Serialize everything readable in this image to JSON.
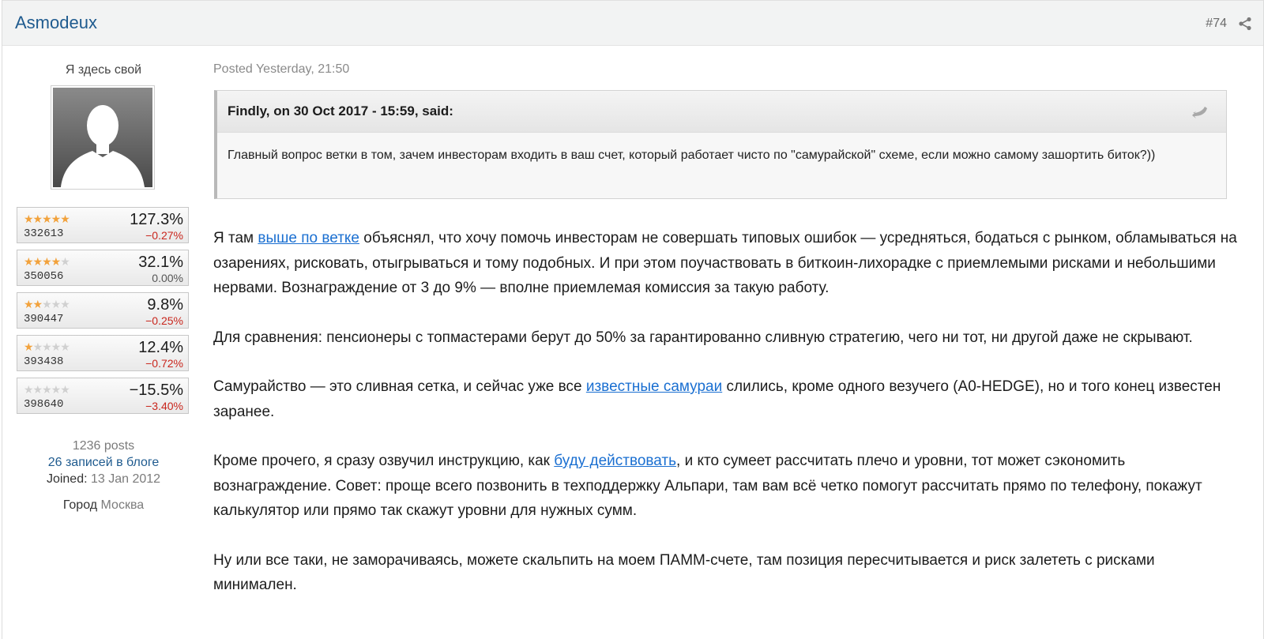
{
  "header": {
    "author": "Asmodeux",
    "post_number": "#74",
    "share_icon": "share-icon"
  },
  "author": {
    "member_title": "Я здесь свой",
    "avatar_icon": "default-avatar-icon",
    "ratings": [
      {
        "stars": 4.5,
        "id": "332613",
        "pct": "127.3%",
        "change": "−0.27%",
        "change_color": "#c9261d"
      },
      {
        "stars": 3.5,
        "id": "350056",
        "pct": "32.1%",
        "change": "0.00%",
        "change_color": "#555555"
      },
      {
        "stars": 1.5,
        "id": "390447",
        "pct": "9.8%",
        "change": "−0.25%",
        "change_color": "#c9261d"
      },
      {
        "stars": 1,
        "id": "393438",
        "pct": "12.4%",
        "change": "−0.72%",
        "change_color": "#c9261d"
      },
      {
        "stars": 0,
        "id": "398640",
        "pct": "−15.5%",
        "change": "−3.40%",
        "change_color": "#c9261d"
      }
    ],
    "posts": "1236 posts",
    "blog": "26 записей в блоге",
    "joined_label": "Joined:",
    "joined_value": " 13 Jan 2012",
    "city_label": "Город",
    "city_value": " Москва"
  },
  "post": {
    "posted": "Posted Yesterday, 21:50",
    "quote": {
      "cite": "Findly, on 30 Oct 2017 - 15:59, said:",
      "text": "Главный вопрос ветки в том, зачем инвесторам входить в ваш счет, который работает чисто по \"самурайской\" схеме, если можно самому зашортить биток?))"
    },
    "p1": {
      "a": "Я там ",
      "link": "выше по ветке",
      "b": " объяснял, что хочу помочь инвесторам не совершать типовых ошибок — усредняться, бодаться с рынком, обламываться на озарениях, рисковать, отыгрываться и тому подобных. И при этом поучаствовать в биткоин-лихорадке с приемлемыми рисками и небольшими нервами. Вознаграждение от 3 до 9% — вполне приемлемая комиссия за такую работу."
    },
    "p2": "Для сравнения: пенсионеры с топмастерами берут до 50% за гарантированно сливную стратегию, чего ни тот, ни другой даже не скрывают.",
    "p3": {
      "a": "Самурайство — это сливная сетка, и сейчас уже все ",
      "link": "известные самураи",
      "b": " слились, кроме одного везучего (A0-HEDGE), но и того конец известен заранее."
    },
    "p4": {
      "a": "Кроме прочего, я сразу озвучил инструкцию, как ",
      "link": "буду действовать",
      "b": ", и кто сумеет рассчитать плечо и уровни, тот может сэкономить вознаграждение. Совет: проще всего позвонить в техподдержку Альпари, там вам всё четко помогут рассчитать прямо по телефону, покажут калькулятор или прямо так скажут уровни для нужных сумм."
    },
    "p5": "Ну или все таки, не заморачиваясь, можете скальпить на моем ПАММ-счете, там позиция пересчитывается и риск залететь с рисками минимален."
  },
  "colors": {
    "link": "#1a6fd1",
    "author": "#1f5b8f",
    "negative": "#c9261d",
    "star": "#f2a23c"
  }
}
